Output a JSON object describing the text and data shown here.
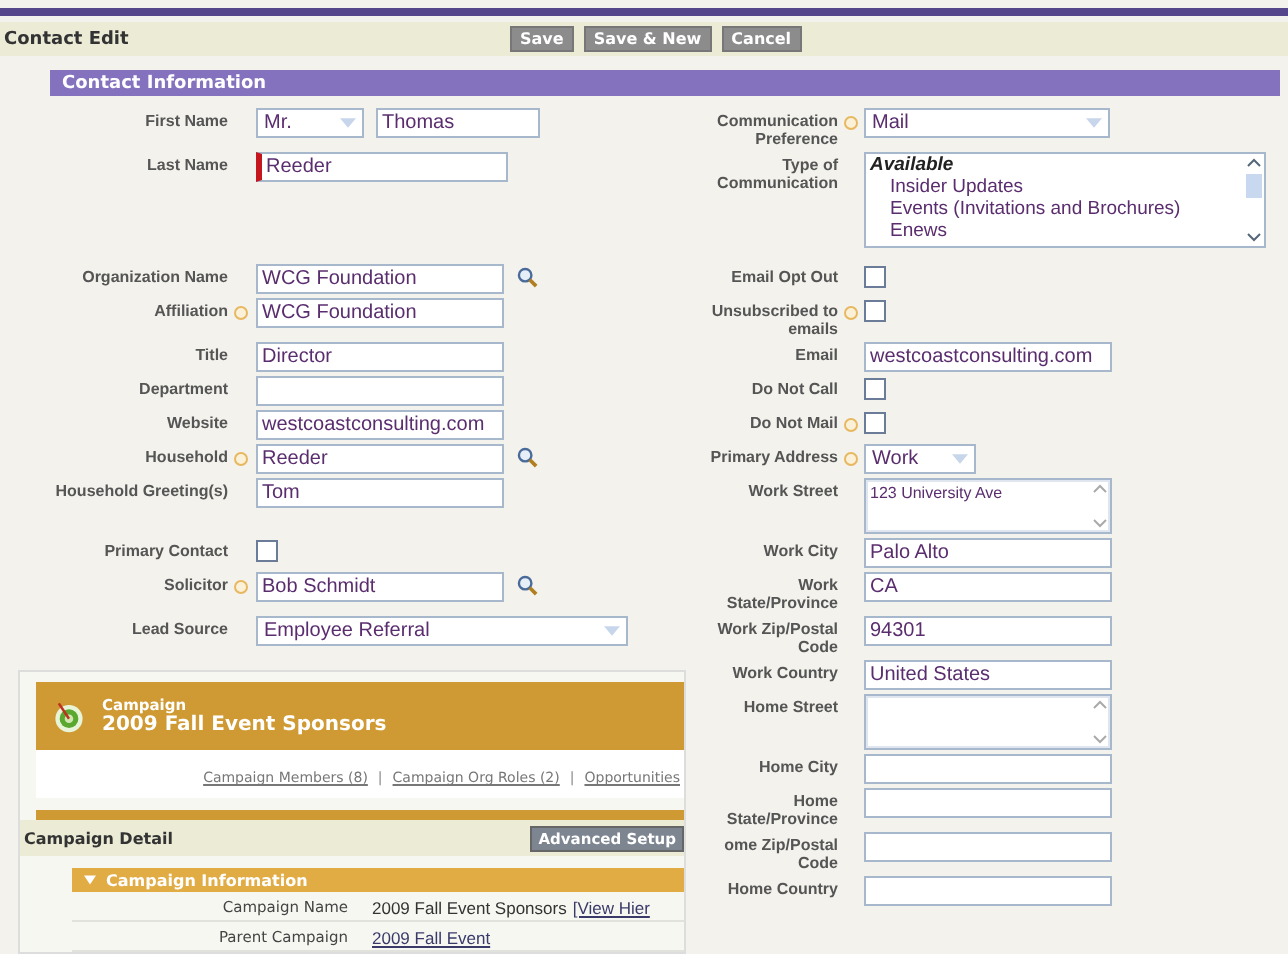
{
  "header": {
    "title": "Contact Edit",
    "buttons": [
      "Save",
      "Save & New",
      "Cancel"
    ]
  },
  "section": {
    "title": "Contact Information"
  },
  "rows": [
    {
      "left": {
        "label": "First Name",
        "help": false,
        "kind": "salutation",
        "salutation": "Mr.",
        "value": "Thomas"
      },
      "right": {
        "label": "Communication Preference",
        "help": true,
        "kind": "select",
        "value": "Mail"
      }
    },
    {
      "left": {
        "label": "Last Name",
        "help": false,
        "kind": "text",
        "required": true,
        "value": "Reeder"
      },
      "right": {
        "label": "Type of Communication",
        "help": false,
        "kind": "listbox",
        "header": "Available",
        "options": [
          "Insider Updates",
          "Events (Invitations and Brochures)",
          "Enews"
        ]
      }
    },
    {
      "left": {
        "label": "Organization Name",
        "help": false,
        "kind": "lookup",
        "value": "WCG Foundation"
      },
      "right": {
        "label": "Email Opt Out",
        "help": false,
        "kind": "checkbox",
        "checked": false
      }
    },
    {
      "left": {
        "label": "Affiliation",
        "help": true,
        "kind": "text",
        "value": "WCG Foundation"
      },
      "right": {
        "label": "Unsubscribed to emails",
        "help": true,
        "kind": "checkbox",
        "checked": false
      }
    },
    {
      "left": {
        "label": "Title",
        "help": false,
        "kind": "text",
        "value": "Director"
      },
      "right": {
        "label": "Email",
        "help": false,
        "kind": "text",
        "value": "westcoastconsulting.com"
      }
    },
    {
      "left": {
        "label": "Department",
        "help": false,
        "kind": "text"
      },
      "right": {
        "label": "Do Not Call",
        "help": false,
        "kind": "checkbox",
        "checked": false
      }
    },
    {
      "left": {
        "label": "Website",
        "help": false,
        "kind": "text",
        "value": "westcoastconsulting.com"
      },
      "right": {
        "label": "Do Not Mail",
        "help": true,
        "kind": "checkbox",
        "checked": false
      }
    },
    {
      "left": {
        "label": "Household",
        "help": true,
        "kind": "lookup",
        "value": "Reeder"
      },
      "right": {
        "label": "Primary Address",
        "help": true,
        "kind": "small_select",
        "value": "Work"
      }
    },
    {
      "left": {
        "label": "Household Greeting(s)",
        "help": false,
        "kind": "text",
        "value": "Tom"
      },
      "right": {
        "label": "Work Street",
        "help": false,
        "kind": "textarea",
        "value": "123 University Ave"
      }
    },
    {
      "left": {
        "label": "Primary Contact",
        "help": false,
        "kind": "checkbox",
        "checked": false
      },
      "right": {
        "label": "Work City",
        "help": false,
        "kind": "text",
        "value": "Palo Alto"
      }
    },
    {
      "left": {
        "label": "Solicitor",
        "help": true,
        "kind": "lookup",
        "value": "Bob Schmidt"
      },
      "right": {
        "label": "Work State/Province",
        "help": false,
        "kind": "text",
        "value": "CA"
      }
    },
    {
      "left": {
        "label": "Lead Source",
        "help": false,
        "kind": "wide_select",
        "value": "Employee Referral"
      },
      "right": {
        "label": "Work Zip/Postal Code",
        "help": false,
        "kind": "text",
        "value": "94301"
      }
    },
    {
      "right": {
        "label": "Work Country",
        "help": false,
        "kind": "text",
        "value": "United States"
      }
    },
    {
      "right": {
        "label": "Home Street",
        "help": false,
        "kind": "textarea"
      }
    },
    {
      "right": {
        "label": "Home City",
        "help": false,
        "kind": "text"
      }
    },
    {
      "right": {
        "label": "Home State/Province",
        "help": false,
        "kind": "text"
      }
    },
    {
      "right": {
        "label": "ome Zip/Postal Code",
        "help": false,
        "kind": "text"
      }
    },
    {
      "right": {
        "label": "Home Country",
        "help": false,
        "kind": "text"
      }
    }
  ],
  "campaign": {
    "kicker": "Campaign",
    "name": "2009 Fall Event Sponsors",
    "links": [
      {
        "kind": "link",
        "text": "Campaign Members (8)"
      },
      {
        "kind": "separator",
        "text": "|"
      },
      {
        "kind": "link",
        "text": "Campaign Org Roles (2)"
      },
      {
        "kind": "separator",
        "text": "|"
      },
      {
        "kind": "link",
        "text": "Opportunities"
      }
    ],
    "detail_title": "Campaign Detail",
    "detail_button": "Advanced Setup",
    "info_title": "Campaign Information",
    "info_expanded": true,
    "fields": [
      {
        "label": "Campaign Name",
        "value": "2009 Fall Event Sponsors",
        "link": "[View Hier"
      },
      {
        "label": "Parent Campaign",
        "value": "2009 Fall Event"
      }
    ]
  }
}
